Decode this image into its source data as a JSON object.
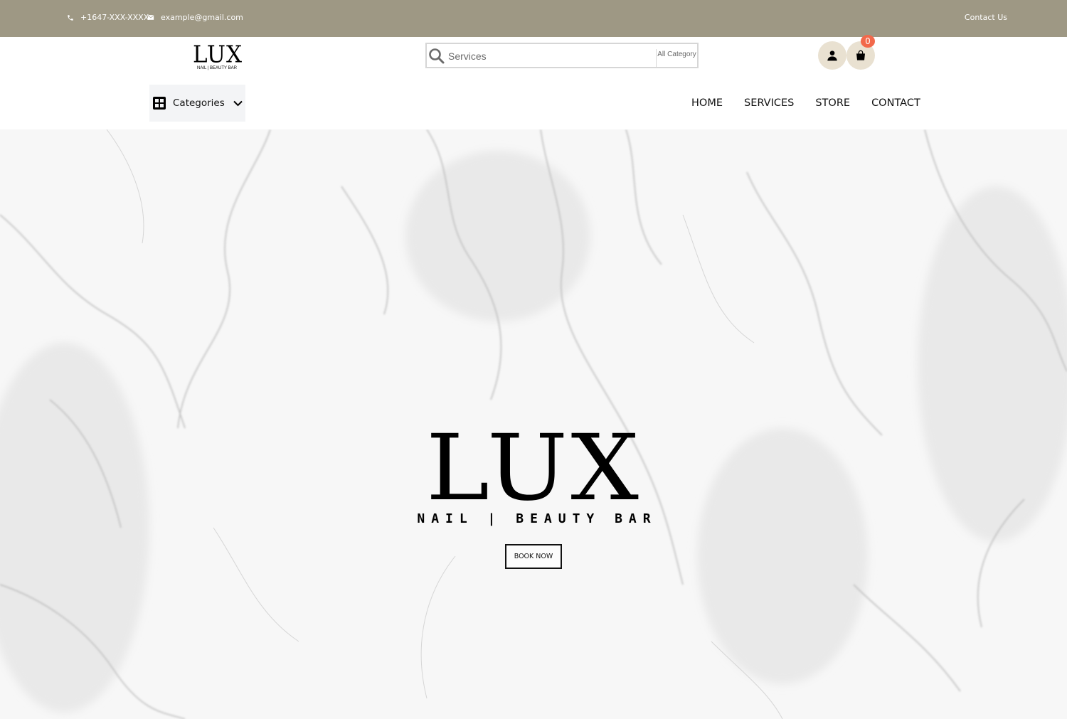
{
  "topbar": {
    "phone": "+1647-XXX-XXXX",
    "phone_icon": "phone-icon",
    "email": "example@gmail.com",
    "email_icon": "envelope-icon",
    "contact_link": "Contact Us",
    "background_color": "#9e9884"
  },
  "header": {
    "logo_text": "LUX",
    "logo_subtitle": "NAIL | BEAUTY BAR",
    "search": {
      "placeholder": "Services",
      "value": "",
      "category_label": "All Category",
      "icon": "search-icon"
    },
    "account_icon": "user-icon",
    "cart_icon": "shopping-bag-icon",
    "cart_count": "0",
    "badge_color": "#f2694b",
    "circle_color": "#e9e1d1"
  },
  "nav": {
    "categories_label": "Categories",
    "categories_icon": "grid-icon",
    "items": [
      {
        "label": "HOME"
      },
      {
        "label": "SERVICES"
      },
      {
        "label": "STORE"
      },
      {
        "label": "CONTACT"
      }
    ]
  },
  "hero": {
    "title": "LUX",
    "subtitle": "NAIL | BEAUTY BAR",
    "cta": "BOOK NOW"
  }
}
